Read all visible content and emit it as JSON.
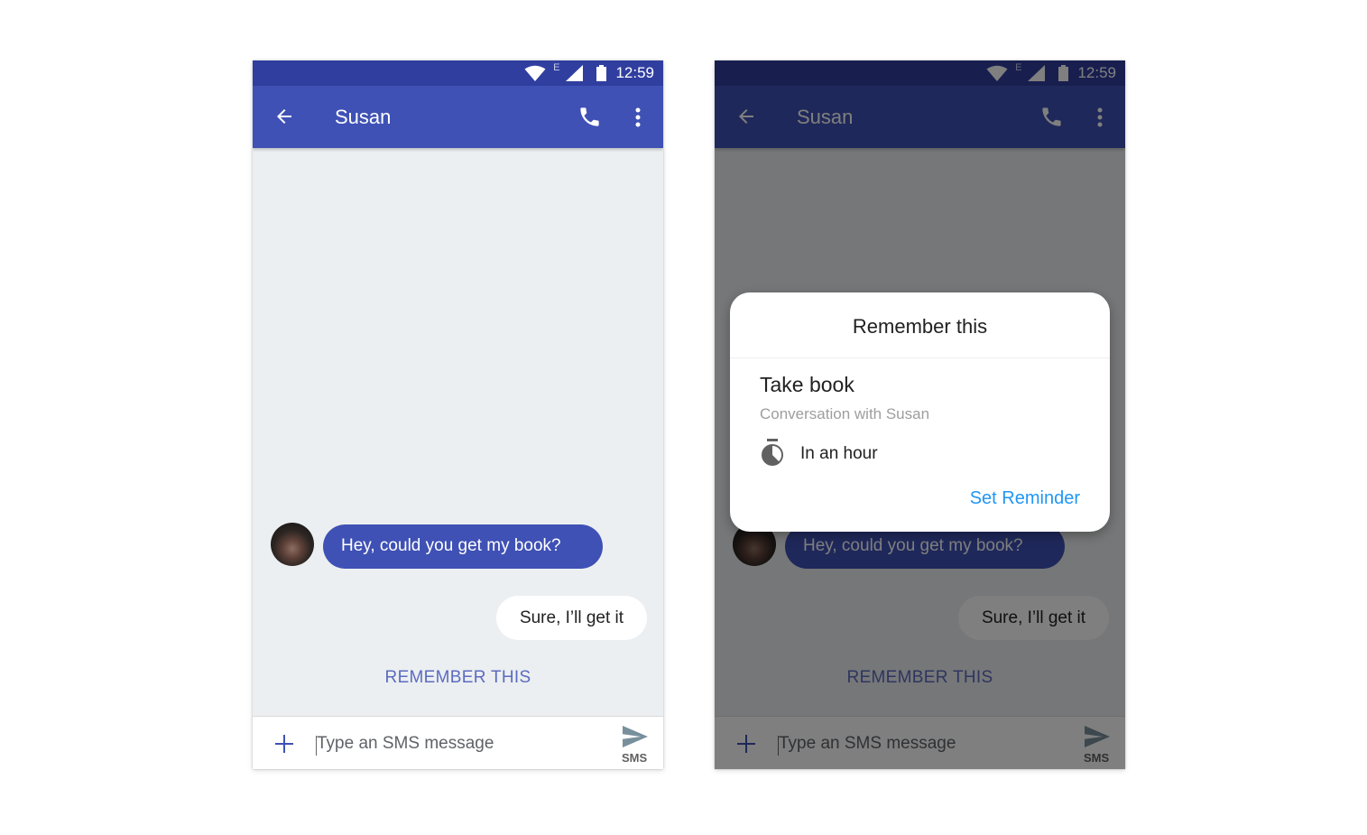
{
  "status_bar": {
    "network_type": "E",
    "time": "12:59"
  },
  "app_bar": {
    "title": "Susan"
  },
  "messages": {
    "incoming": "Hey, could you get my book?",
    "outgoing": "Sure, I’ll get it"
  },
  "suggestion": {
    "label": "REMEMBER THIS"
  },
  "compose": {
    "placeholder": "Type an SMS message",
    "send_label": "SMS"
  },
  "dialog": {
    "title": "Remember this",
    "reminder_title": "Take book",
    "reminder_subtitle": "Conversation with Susan",
    "reminder_time": "In an hour",
    "action_label": "Set Reminder"
  },
  "icons": [
    "wifi-icon",
    "signal-icon",
    "battery-icon",
    "back-arrow-icon",
    "phone-icon",
    "more-vert-icon",
    "plus-icon",
    "send-icon",
    "timer-icon"
  ],
  "colors": {
    "primary": "#3f51b5",
    "primary_dark": "#303f9f",
    "accent": "#5c6bc0",
    "link": "#2196f3",
    "background": "#eceff1"
  }
}
